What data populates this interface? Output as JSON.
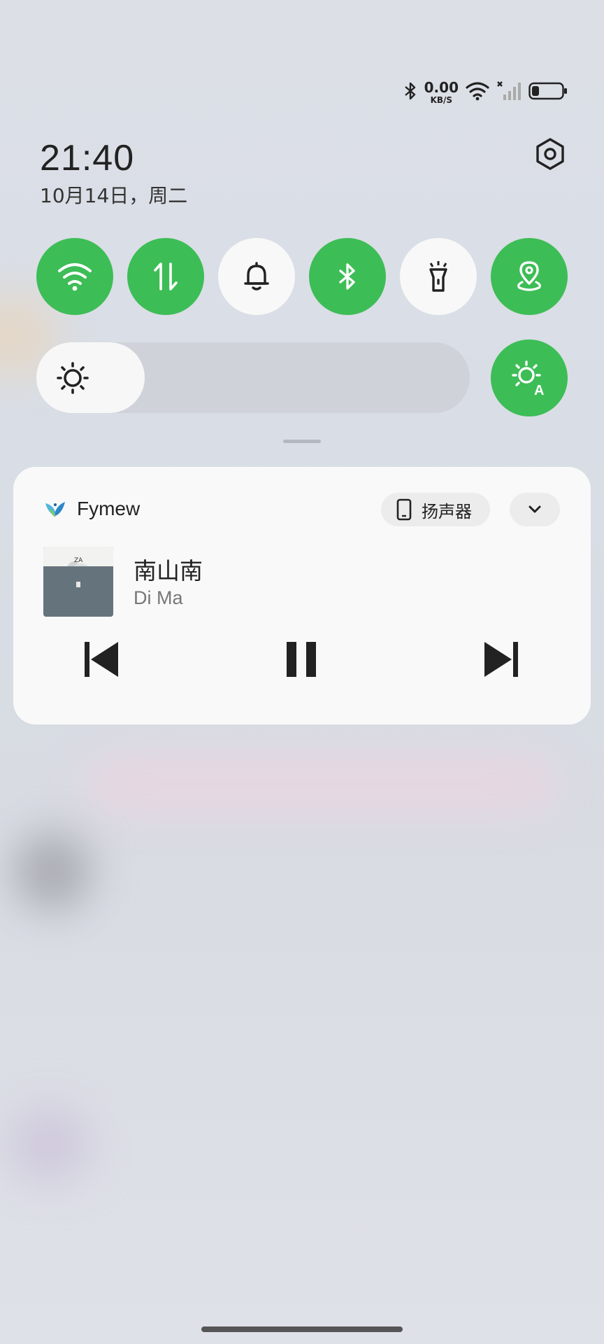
{
  "status_bar": {
    "net_speed_value": "0.00",
    "net_speed_unit": "KB/S",
    "icons": [
      "bluetooth-icon",
      "wifi-icon",
      "cellular-no-service-icon",
      "battery-icon"
    ]
  },
  "clock": {
    "time": "21:40",
    "date": "10月14日，周二"
  },
  "quick_settings": {
    "tiles": [
      {
        "name": "wifi",
        "icon": "wifi-icon",
        "on": true
      },
      {
        "name": "mobile-data",
        "icon": "data-arrows-icon",
        "on": true
      },
      {
        "name": "ringer",
        "icon": "bell-icon",
        "on": false
      },
      {
        "name": "bluetooth",
        "icon": "bluetooth-icon",
        "on": true
      },
      {
        "name": "flashlight",
        "icon": "flashlight-icon",
        "on": false
      },
      {
        "name": "location",
        "icon": "location-icon",
        "on": true
      }
    ],
    "brightness_level": 0.25,
    "auto_brightness_on": true
  },
  "media": {
    "app_name": "Fymew",
    "output_label": "扬声器",
    "song_title": "南山南",
    "artist": "Di Ma",
    "state": "playing"
  },
  "colors": {
    "accent": "#3dbd56",
    "tile_off": "#f8f8f8",
    "card": "#f9f9f9"
  }
}
